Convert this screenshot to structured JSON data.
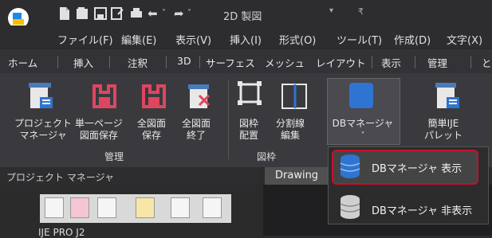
{
  "titlebar": {
    "doc_title": "2D 製図",
    "dropdown_glyph": "▾",
    "menu_glyph": "₹"
  },
  "quick_access": {
    "new_icon": "new-file-icon",
    "open_icon": "open-file-icon",
    "save_icon": "save-icon",
    "saveas_icon": "save-as-icon",
    "print_icon": "print-icon",
    "undo_icon": "undo-icon",
    "redo_icon": "redo-icon",
    "undo_glyph": "⬅",
    "undo_arrow": "˅",
    "redo_glyph": "➦",
    "redo_arrow": "˅"
  },
  "menu": [
    "ファイル(F)",
    "編集(E)",
    "表示(V)",
    "挿入(I)",
    "形式(O)",
    "ツール(T)",
    "作成(D)",
    "文字(X)"
  ],
  "tabs": [
    "ホーム",
    "挿入",
    "注釈",
    "3D",
    "サーフェス",
    "メッシュ",
    "レイアウト",
    "表示",
    "管理",
    "と"
  ],
  "ribbon": {
    "buttons": [
      {
        "line1": "プロジェクト",
        "line2": "マネージャ"
      },
      {
        "line1": "単一ページ",
        "line2": "図面保存"
      },
      {
        "line1": "全図面",
        "line2": "保存"
      },
      {
        "line1": "全図面",
        "line2": "終了"
      },
      {
        "line1": "図枠",
        "line2": "配置"
      },
      {
        "line1": "分割線",
        "line2": "編集"
      },
      {
        "line1": "DBマネージャ",
        "line2": "˅"
      },
      {
        "line1": "簡単IJE",
        "line2": "パレット"
      }
    ],
    "groups": [
      "管理",
      "図枠"
    ],
    "colors": {
      "accent_red": "#e0455f",
      "accent_blue": "#2f74d0"
    }
  },
  "panel": {
    "title": "プロジェクト マネージャ",
    "tree_item": "IJE PRO J2"
  },
  "document_tab": "Drawing",
  "dropdown": {
    "items": [
      {
        "label": "DBマネージャ 表示",
        "icon": "database-blue-icon"
      },
      {
        "label": "DBマネージャ 非表示",
        "icon": "database-gray-icon"
      }
    ],
    "highlight_color": "#c8102e"
  }
}
